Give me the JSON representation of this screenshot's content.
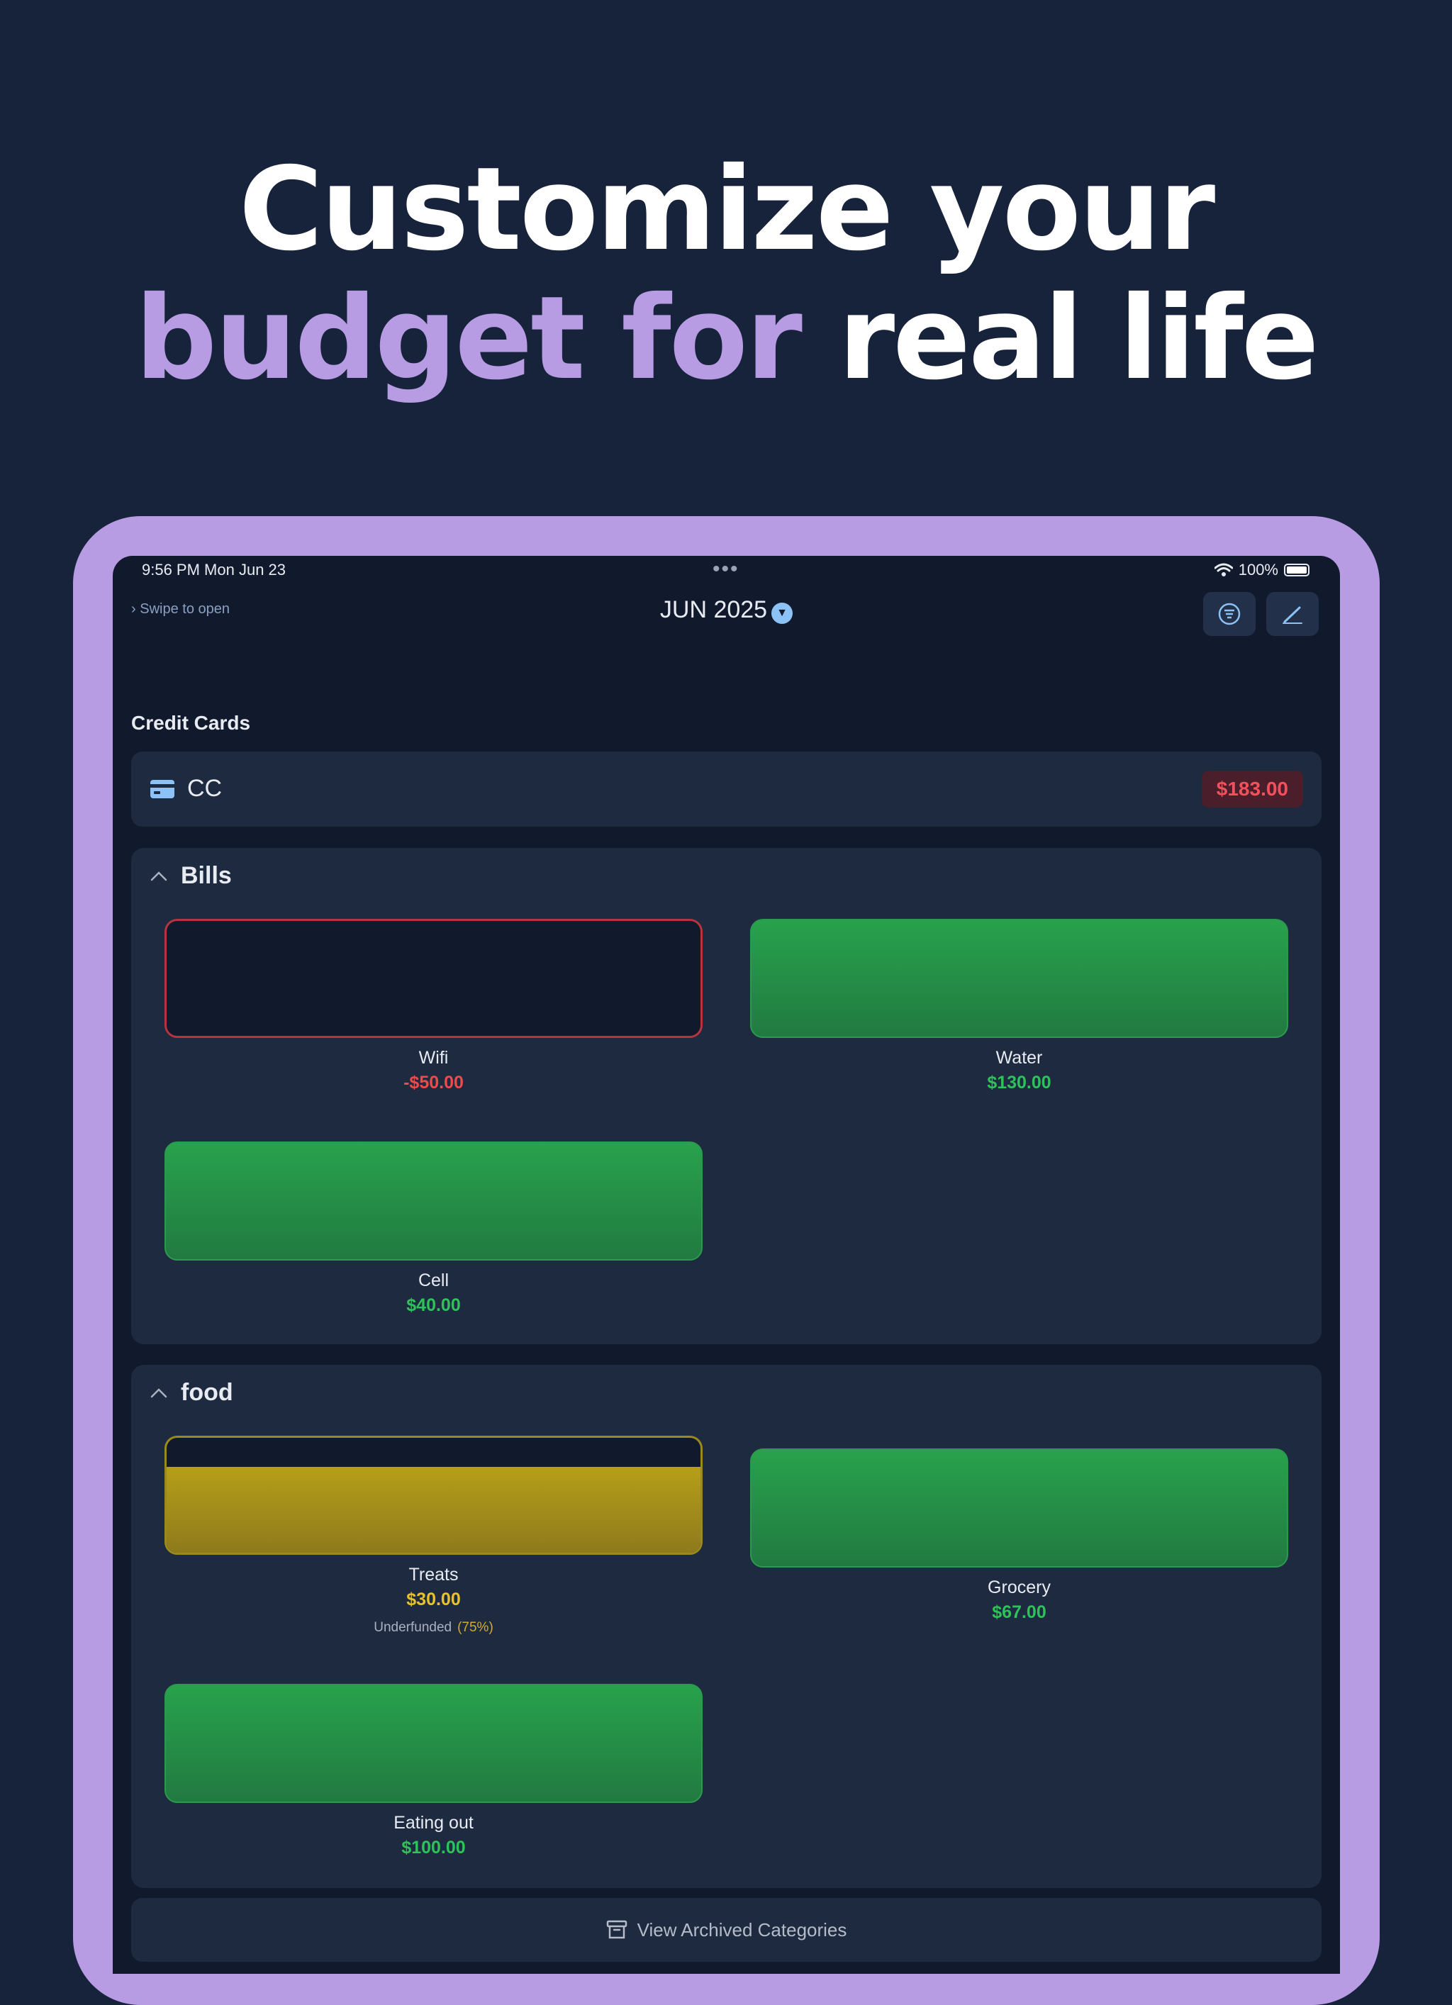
{
  "headline": {
    "line1": "Customize your",
    "line2_accent": "budget for",
    "line2_rest": "real life",
    "accent_color": "#b79be3"
  },
  "status_bar": {
    "time": "9:56 PM   Mon Jun 23",
    "dots": "•••",
    "battery": "100%"
  },
  "nav": {
    "swipe_hint": "Swipe to open",
    "month": "JUN 2025",
    "filter_icon": "list-filter-icon",
    "edit_icon": "pencil-icon"
  },
  "credit_cards": {
    "title": "Credit Cards",
    "card": {
      "name": "CC",
      "amount": "$183.00",
      "icon": "credit-card-icon"
    }
  },
  "groups": [
    {
      "name": "Bills",
      "categories": [
        {
          "name": "Wifi",
          "amount": "-$50.00",
          "status": "overspent"
        },
        {
          "name": "Water",
          "amount": "$130.00",
          "status": "funded"
        },
        {
          "name": "Cell",
          "amount": "$40.00",
          "status": "funded"
        }
      ]
    },
    {
      "name": "food",
      "categories": [
        {
          "name": "Treats",
          "amount": "$30.00",
          "status": "underfunded",
          "note": "Underfunded",
          "percent": "(75%)",
          "funded_fraction": 0.75
        },
        {
          "name": "Grocery",
          "amount": "$67.00",
          "status": "funded"
        },
        {
          "name": "Eating out",
          "amount": "$100.00",
          "status": "funded"
        }
      ]
    }
  ],
  "archived_link": "View Archived Categories",
  "colors": {
    "background": "#17233b",
    "device_frame": "#b79be3",
    "funded": "#2dc25a",
    "overspent": "#ef4a4a",
    "underfunded": "#e7c22a"
  }
}
